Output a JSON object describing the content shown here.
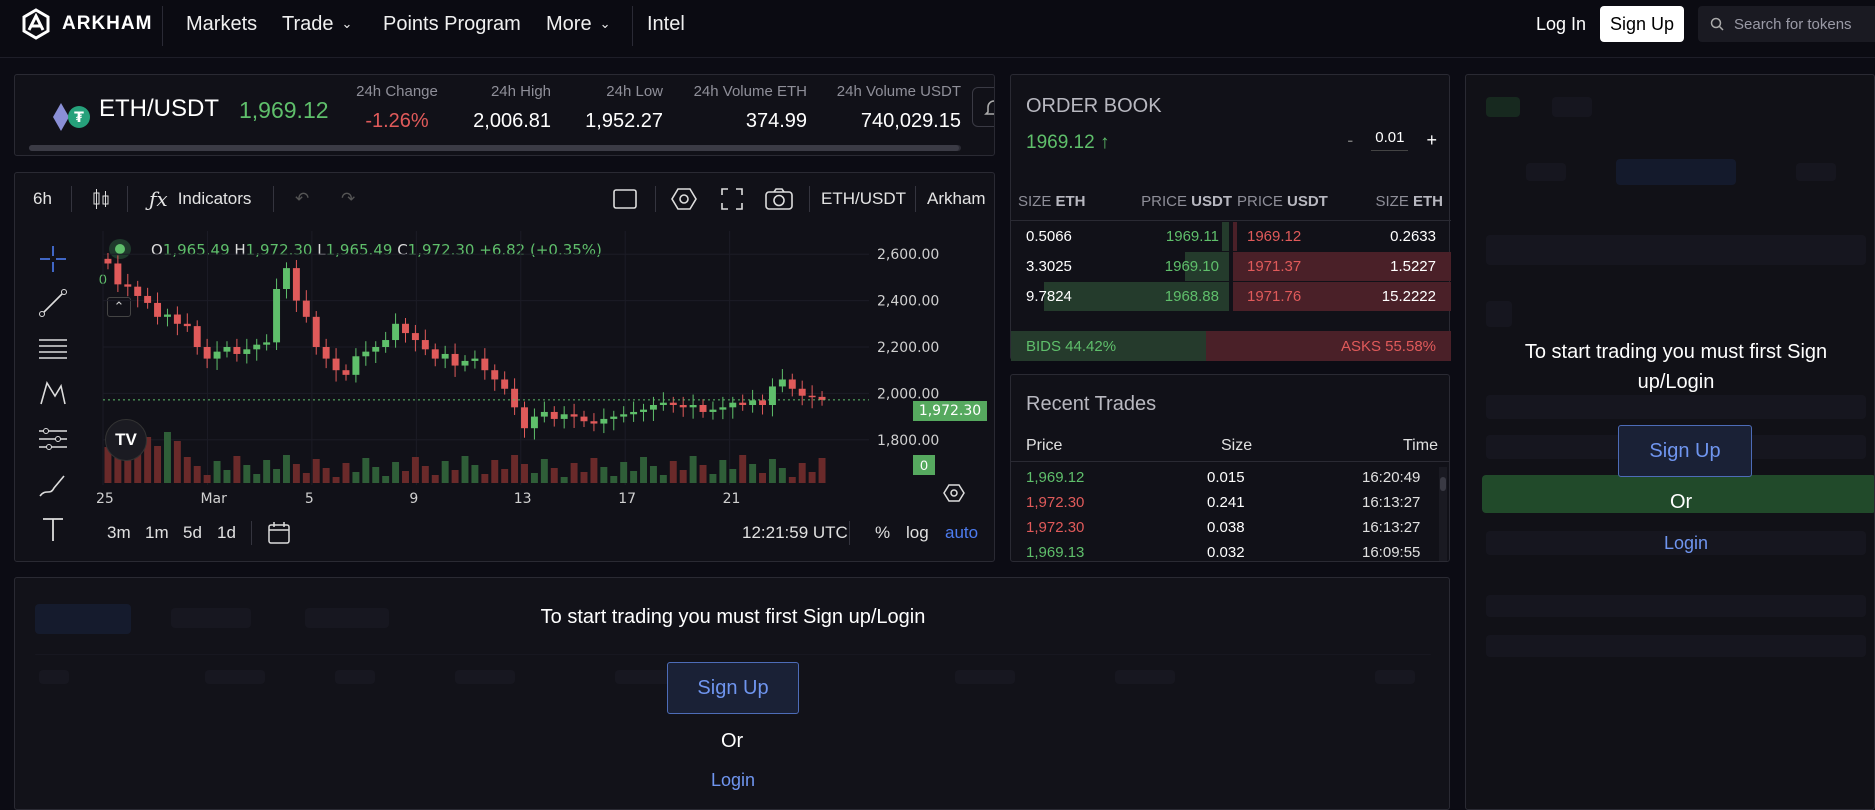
{
  "nav": {
    "brand": "ARKHAM",
    "items": [
      "Markets",
      "Trade",
      "Points Program",
      "More",
      "Intel"
    ],
    "login": "Log In",
    "signup": "Sign Up",
    "search_placeholder": "Search for tokens"
  },
  "ticker": {
    "pair": "ETH/USDT",
    "price": "1,969.12",
    "stats": [
      {
        "label": "24h Change",
        "value": "-1.26%"
      },
      {
        "label": "24h High",
        "value": "2,006.81"
      },
      {
        "label": "24h Low",
        "value": "1,952.27"
      },
      {
        "label": "24h Volume ETH",
        "value": "374.99"
      },
      {
        "label": "24h Volume USDT",
        "value": "740,029.15"
      }
    ]
  },
  "chart_toolbar": {
    "interval": "6h",
    "indicators": "Indicators",
    "symbol": "ETH/USDT",
    "source": "Arkham"
  },
  "chart": {
    "ohlc_o": "1,965.49",
    "ohlc_h": "1,972.30",
    "ohlc_l": "1,965.49",
    "ohlc_c": "1,972.30",
    "ohlc_change": "+6.82 (+0.35%)",
    "price_label": "1,972.30",
    "volume_label": "0",
    "legend_zero": "0",
    "time": "12:21:59 UTC",
    "ranges": [
      "3m",
      "1m",
      "5d",
      "1d"
    ],
    "modes": [
      "%",
      "log",
      "auto"
    ]
  },
  "chart_data": {
    "type": "line",
    "title": "",
    "xlabel": "",
    "ylabel": "",
    "xticks": [
      "25",
      "Mar",
      "5",
      "9",
      "13",
      "17",
      "21"
    ],
    "yticks": [
      "2,600.00",
      "2,400.00",
      "2,200.00",
      "2,000.00",
      "1,800.00"
    ],
    "ylim": [
      1700,
      2700
    ],
    "series": [
      {
        "name": "ETH/USDT",
        "values": [
          2560,
          2470,
          2460,
          2420,
          2390,
          2330,
          2340,
          2300,
          2290,
          2200,
          2150,
          2180,
          2200,
          2170,
          2190,
          2210,
          2220,
          2450,
          2540,
          2400,
          2330,
          2200,
          2150,
          2100,
          2080,
          2160,
          2180,
          2200,
          2230,
          2300,
          2260,
          2230,
          2190,
          2150,
          2170,
          2120,
          2140,
          2150,
          2100,
          2060,
          2020,
          1940,
          1850,
          1900,
          1920,
          1890,
          1910,
          1900,
          1880,
          1870,
          1890,
          1900,
          1910,
          1920,
          1930,
          1950,
          1960,
          1950,
          1940,
          1950,
          1920,
          1930,
          1940,
          1960,
          1950,
          1970,
          1950,
          2030,
          2060,
          2020,
          1990,
          1985,
          1972
        ]
      }
    ]
  },
  "orderbook": {
    "title": "ORDER BOOK",
    "mid": "1969.12",
    "step": "0.01",
    "headers": [
      "SIZE",
      "ETH",
      "PRICE",
      "USDT",
      "PRICE",
      "USDT",
      "SIZE",
      "ETH"
    ],
    "rows": [
      {
        "bid_size": "0.5066",
        "bid_price": "1969.11",
        "ask_price": "1969.12",
        "ask_size": "0.2633",
        "bid_depth": 0.03,
        "ask_depth": 0.02
      },
      {
        "bid_size": "3.3025",
        "bid_price": "1969.10",
        "ask_price": "1971.37",
        "ask_size": "1.5227",
        "bid_depth": 0.2,
        "ask_depth": 1.0
      },
      {
        "bid_size": "9.7824",
        "bid_price": "1968.88",
        "ask_price": "1971.76",
        "ask_size": "15.2222",
        "bid_depth": 0.85,
        "ask_depth": 1.0
      }
    ],
    "bids": "BIDS 44.42%",
    "asks": "ASKS 55.58%",
    "bids_pct": 44.42
  },
  "recent_trades": {
    "title": "Recent Trades",
    "headers": [
      "Price",
      "Size",
      "Time"
    ],
    "rows": [
      {
        "price": "1,969.12",
        "size": "0.015",
        "time": "16:20:49",
        "side": "buy"
      },
      {
        "price": "1,972.30",
        "size": "0.241",
        "time": "16:13:27",
        "side": "sell"
      },
      {
        "price": "1,972.30",
        "size": "0.038",
        "time": "16:13:27",
        "side": "sell"
      },
      {
        "price": "1,969.13",
        "size": "0.032",
        "time": "16:09:55",
        "side": "buy"
      }
    ]
  },
  "cta": {
    "text": "To start trading you must first Sign up/Login",
    "signup": "Sign Up",
    "or": "Or",
    "login": "Login"
  },
  "colors": {
    "up": "#5fbf6b",
    "down": "#e05a5a",
    "accent": "#6f95ef"
  }
}
